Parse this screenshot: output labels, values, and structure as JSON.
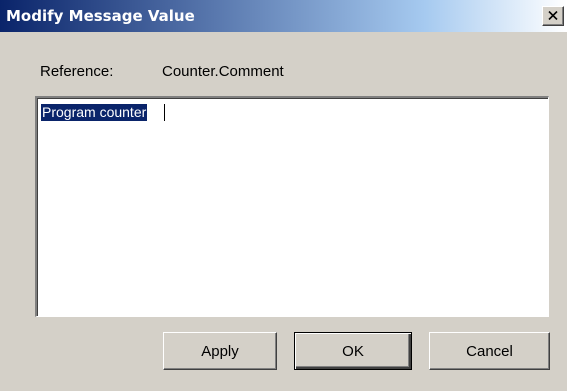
{
  "window": {
    "title": "Modify Message Value",
    "close_label": "X"
  },
  "reference": {
    "label": "Reference:",
    "value": "Counter.Comment"
  },
  "message": {
    "text": "Program counter",
    "selected": true
  },
  "buttons": {
    "apply": "Apply",
    "ok": "OK",
    "cancel": "Cancel"
  },
  "icons": {
    "close": "close-icon"
  },
  "colors": {
    "titlebar_start": "#0a246a",
    "titlebar_end": "#a6caf0",
    "dialog_bg": "#d4d0c8",
    "selection_bg": "#0a246a"
  }
}
